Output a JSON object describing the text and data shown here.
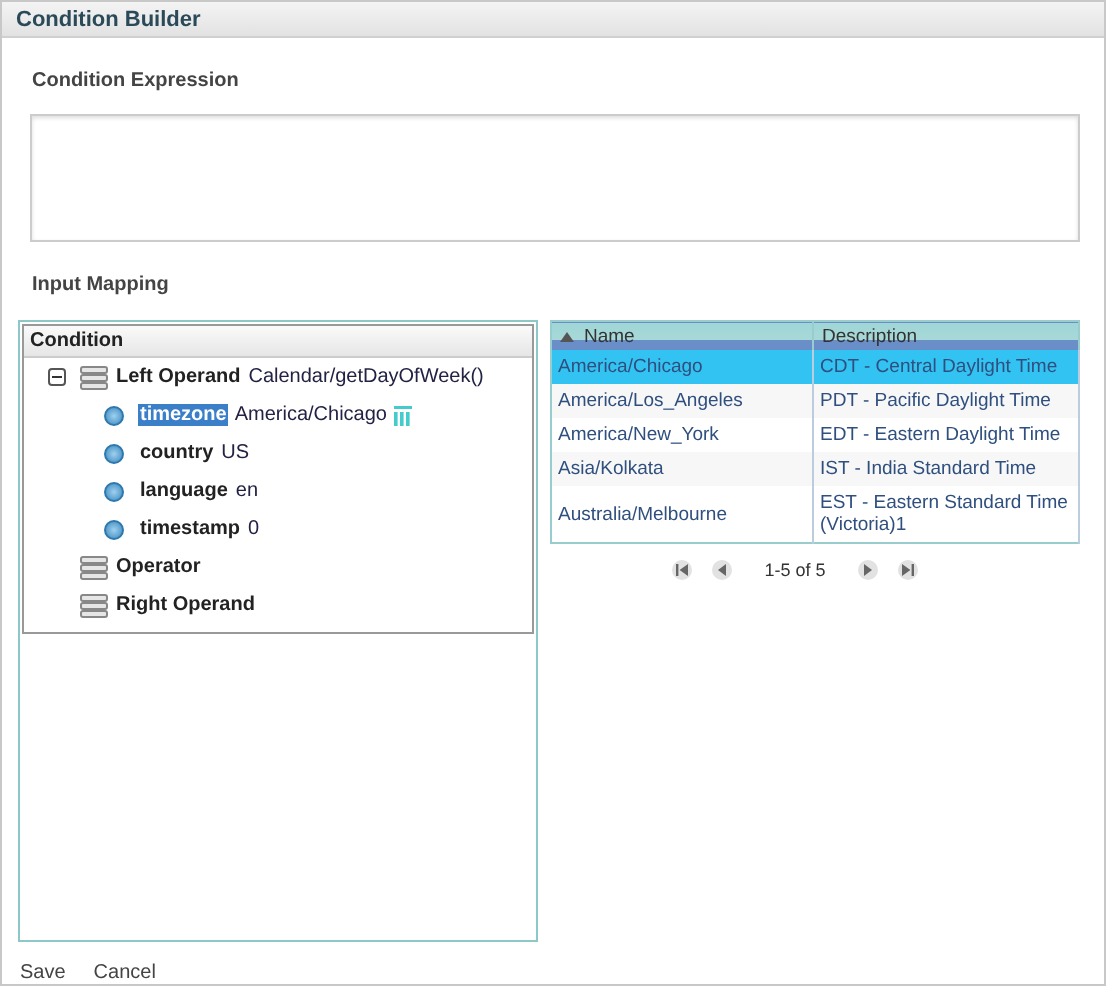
{
  "window": {
    "title": "Condition Builder"
  },
  "expression": {
    "label": "Condition Expression"
  },
  "input_mapping": {
    "label": "Input Mapping"
  },
  "tree": {
    "header": "Condition",
    "nodes": [
      {
        "label": "Left Operand",
        "value": "Calendar/getDayOfWeek()",
        "expanded": true,
        "children": [
          {
            "label": "timezone",
            "value": "America/Chicago",
            "selected": true
          },
          {
            "label": "country",
            "value": "US",
            "selected": false
          },
          {
            "label": "language",
            "value": "en",
            "selected": false
          },
          {
            "label": "timestamp",
            "value": "0",
            "selected": false
          }
        ]
      },
      {
        "label": "Operator"
      },
      {
        "label": "Right Operand"
      }
    ]
  },
  "grid": {
    "columns": [
      {
        "label": "Name",
        "sorted": true
      },
      {
        "label": "Description",
        "sorted": false
      }
    ],
    "rows": [
      {
        "name": "America/Chicago",
        "description": "CDT - Central Daylight Time",
        "selected": true
      },
      {
        "name": "America/Los_Angeles",
        "description": "PDT - Pacific Daylight Time",
        "selected": false
      },
      {
        "name": "America/New_York",
        "description": "EDT - Eastern Daylight Time",
        "selected": false
      },
      {
        "name": "Asia/Kolkata",
        "description": "IST - India Standard Time",
        "selected": false
      },
      {
        "name": "Australia/Melbourne",
        "description": "EST - Eastern Standard Time (Victoria)1",
        "selected": false
      }
    ]
  },
  "pager": {
    "text": "1-5 of 5"
  },
  "buttons": [
    "Save",
    "Cancel"
  ]
}
